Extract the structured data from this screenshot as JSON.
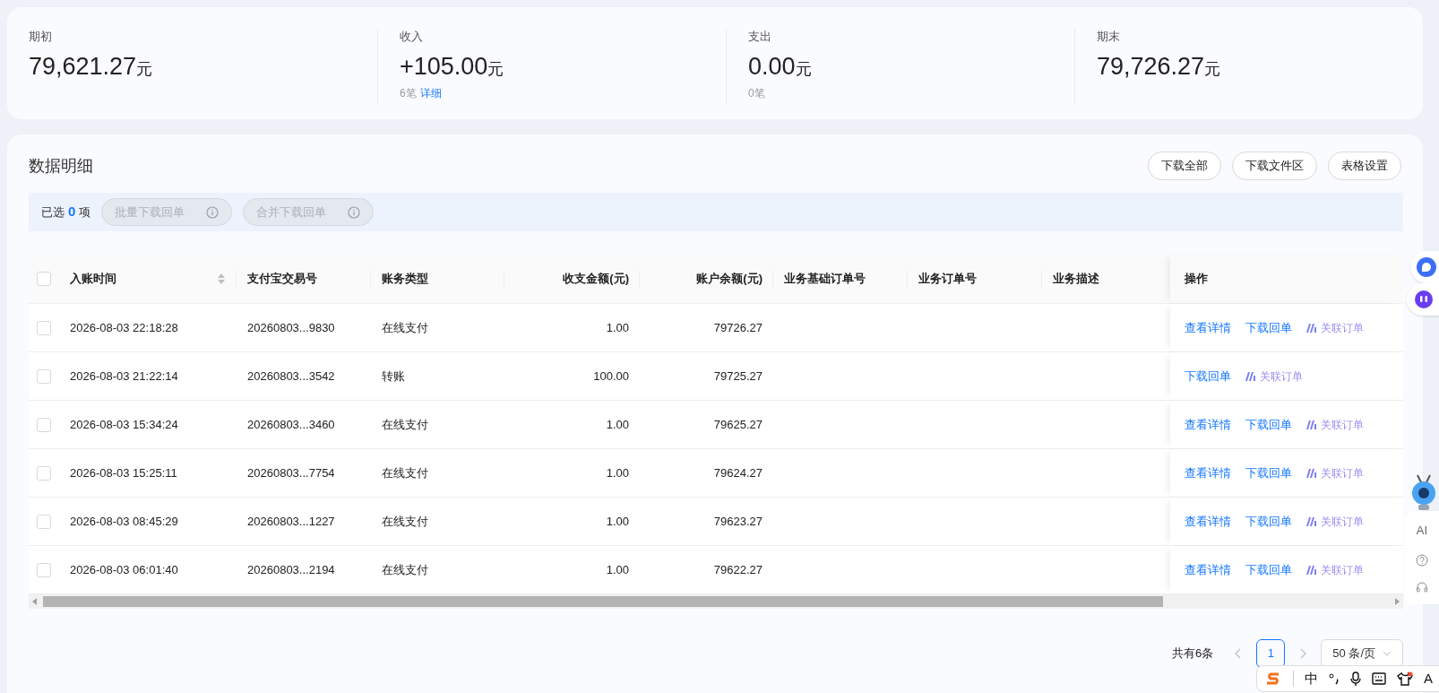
{
  "summary": [
    {
      "label": "期初",
      "amount": "79,621.27",
      "unit": "元"
    },
    {
      "label": "收入",
      "amount": "+105.00",
      "unit": "元",
      "count": "6笔",
      "link": "详细"
    },
    {
      "label": "支出",
      "amount": "0.00",
      "unit": "元",
      "count": "0笔"
    },
    {
      "label": "期末",
      "amount": "79,726.27",
      "unit": "元"
    }
  ],
  "section": {
    "title": "数据明细",
    "buttons": [
      "下载全部",
      "下载文件区",
      "表格设置"
    ]
  },
  "selection_bar": {
    "prefix": "已选",
    "count": "0",
    "suffix": "项",
    "buttons": [
      {
        "label": "批量下载回单",
        "disabled": true
      },
      {
        "label": "合并下载回单",
        "disabled": true
      }
    ]
  },
  "table": {
    "header_checked": false,
    "columns": [
      {
        "label": "入账时间",
        "kind": "text",
        "sortable": true
      },
      {
        "label": "支付宝交易号",
        "kind": "text",
        "sortable": false
      },
      {
        "label": "账务类型",
        "kind": "text",
        "sortable": false
      },
      {
        "label": "收支金额(元)",
        "kind": "amount",
        "sortable": false
      },
      {
        "label": "账户余额(元)",
        "kind": "amount",
        "sortable": false
      },
      {
        "label": "业务基础订单号",
        "kind": "text",
        "sortable": false
      },
      {
        "label": "业务订单号",
        "kind": "text",
        "sortable": false
      },
      {
        "label": "业务描述",
        "kind": "text",
        "sortable": false
      },
      {
        "label": "操作",
        "kind": "text",
        "sortable": false
      }
    ],
    "rows": [
      {
        "checked": false,
        "cells": [
          "2026-08-03 22:18:28",
          "20260803...9830",
          "在线支付",
          "1.00",
          "79726.27"
        ],
        "actions": [
          {
            "kind": "link",
            "label": "查看详情"
          },
          {
            "kind": "link",
            "label": "下载回单"
          },
          {
            "kind": "ai",
            "label": "关联订单"
          }
        ]
      },
      {
        "checked": false,
        "cells": [
          "2026-08-03 21:22:14",
          "20260803...3542",
          "转账",
          "100.00",
          "79725.27"
        ],
        "actions": [
          {
            "kind": "link",
            "label": "下载回单"
          },
          {
            "kind": "ai",
            "label": "关联订单"
          }
        ]
      },
      {
        "checked": false,
        "cells": [
          "2026-08-03 15:34:24",
          "20260803...3460",
          "在线支付",
          "1.00",
          "79625.27"
        ],
        "actions": [
          {
            "kind": "link",
            "label": "查看详情"
          },
          {
            "kind": "link",
            "label": "下载回单"
          },
          {
            "kind": "ai",
            "label": "关联订单"
          }
        ]
      },
      {
        "checked": false,
        "cells": [
          "2026-08-03 15:25:11",
          "20260803...7754",
          "在线支付",
          "1.00",
          "79624.27"
        ],
        "actions": [
          {
            "kind": "link",
            "label": "查看详情"
          },
          {
            "kind": "link",
            "label": "下载回单"
          },
          {
            "kind": "ai",
            "label": "关联订单"
          }
        ]
      },
      {
        "checked": false,
        "cells": [
          "2026-08-03 08:45:29",
          "20260803...1227",
          "在线支付",
          "1.00",
          "79623.27"
        ],
        "actions": [
          {
            "kind": "link",
            "label": "查看详情"
          },
          {
            "kind": "link",
            "label": "下载回单"
          },
          {
            "kind": "ai",
            "label": "关联订单"
          }
        ]
      },
      {
        "checked": false,
        "cells": [
          "2026-08-03 06:01:40",
          "20260803...2194",
          "在线支付",
          "1.00",
          "79622.27"
        ],
        "actions": [
          {
            "kind": "link",
            "label": "查看详情"
          },
          {
            "kind": "link",
            "label": "下载回单"
          },
          {
            "kind": "ai",
            "label": "关联订单"
          }
        ]
      }
    ]
  },
  "pagination": {
    "total": "共有6条",
    "pages": [
      {
        "label": "1",
        "selected": true
      }
    ],
    "page_size": "50 条/页"
  },
  "side_panel": {
    "ai_label": "AI"
  },
  "ime_bar": {
    "mode": "中",
    "last": "A"
  }
}
